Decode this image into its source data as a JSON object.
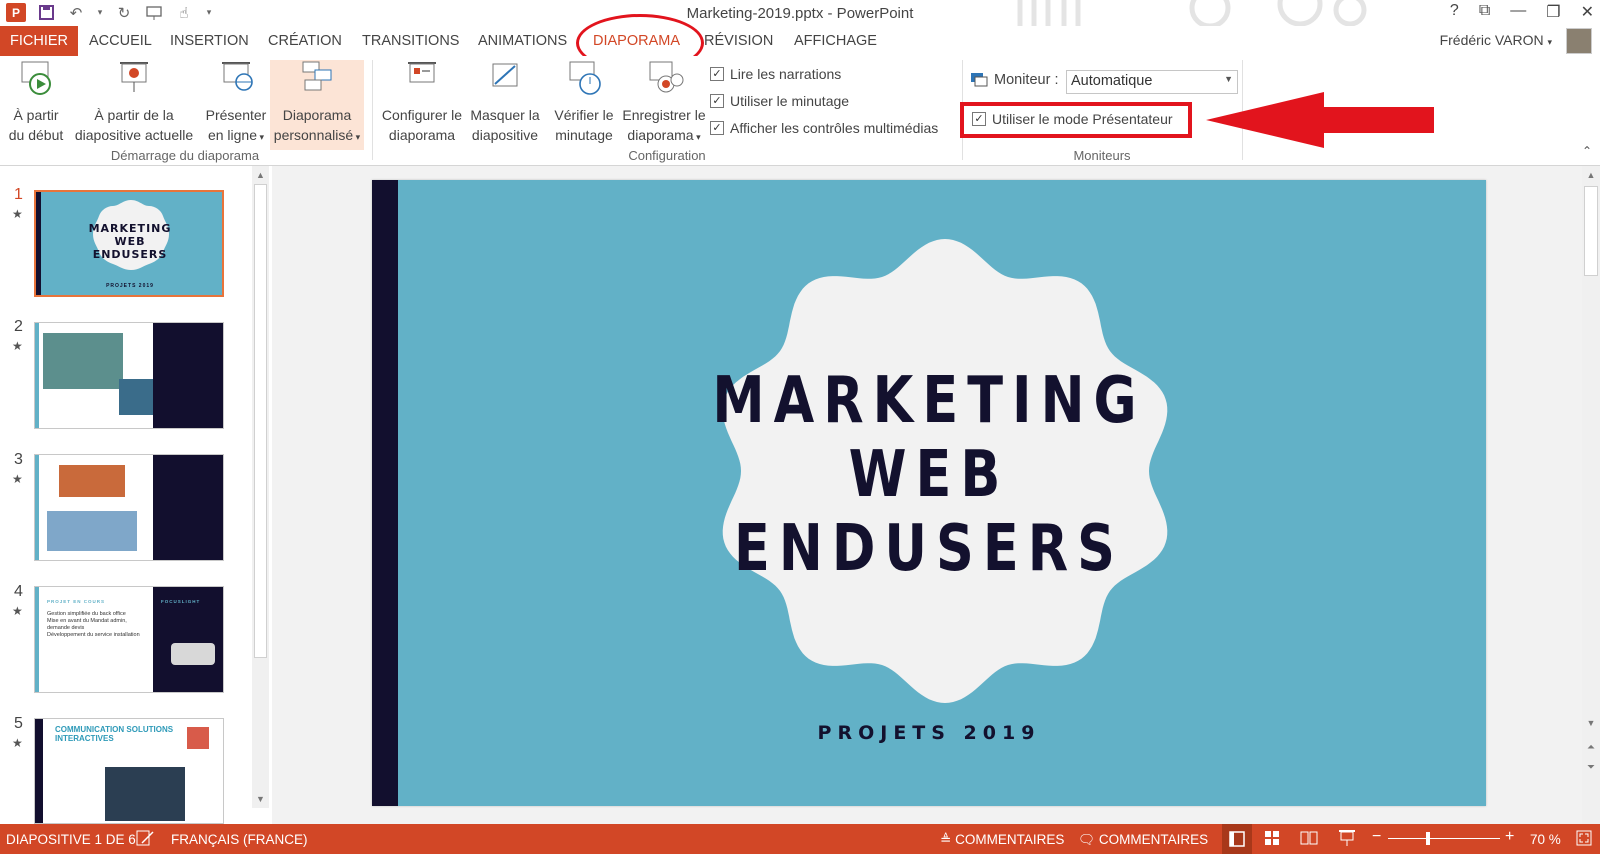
{
  "window": {
    "title": "Marketing-2019.pptx - PowerPoint"
  },
  "quick_access": [
    "powerpoint-logo",
    "save-icon",
    "undo-icon",
    "repeat-icon",
    "present-from-start-icon",
    "touch-mode-icon",
    "customize-icon"
  ],
  "window_controls": {
    "help": "?",
    "restore_ribbon": "⧉",
    "minimize": "—",
    "maximize": "❐",
    "close": "✕"
  },
  "tabs": [
    {
      "label": "FICHIER"
    },
    {
      "label": "ACCUEIL"
    },
    {
      "label": "INSERTION"
    },
    {
      "label": "CRÉATION"
    },
    {
      "label": "TRANSITIONS"
    },
    {
      "label": "ANIMATIONS"
    },
    {
      "label": "DIAPORAMA"
    },
    {
      "label": "RÉVISION"
    },
    {
      "label": "AFFICHAGE"
    }
  ],
  "active_tab": "DIAPORAMA",
  "user": {
    "name": "Frédéric VARON"
  },
  "ribbon": {
    "start": {
      "btn1": [
        "À partir",
        "du début"
      ],
      "btn2": [
        "À partir de la",
        "diapositive actuelle"
      ],
      "btn3": [
        "Présenter",
        "en ligne"
      ],
      "btn4": [
        "Diaporama",
        "personnalisé"
      ],
      "group": "Démarrage du diaporama"
    },
    "config": {
      "btn1": [
        "Configurer le",
        "diaporama"
      ],
      "btn2": [
        "Masquer la",
        "diapositive"
      ],
      "btn3": [
        "Vérifier le",
        "minutage"
      ],
      "btn4": [
        "Enregistrer le",
        "diaporama"
      ],
      "checks": [
        "Lire les narrations",
        "Utiliser le minutage",
        "Afficher les contrôles multimédias"
      ],
      "group": "Configuration"
    },
    "monitors": {
      "label": "Moniteur :",
      "value": "Automatique",
      "presenter": "Utiliser le mode Présentateur",
      "group": "Moniteurs"
    }
  },
  "slides": {
    "numbers": [
      "1",
      "2",
      "3",
      "4",
      "5"
    ],
    "s1": {
      "lines": [
        "MARKETING",
        "WEB",
        "ENDUSERS"
      ],
      "sub": "PROJETS 2019"
    },
    "s4": {
      "header": "PROJET EN COURS",
      "side": "FOCUSLIGHT",
      "bullets": [
        "Gestion simplifiée du back office",
        "Mise en avant du Mandat admin, demande devis",
        "Développement du service installation"
      ]
    },
    "s5": {
      "title": "COMMUNICATION SOLUTIONS INTERACTIVES"
    }
  },
  "main_slide": {
    "lines": [
      "MARKETING",
      "WEB",
      "ENDUSERS"
    ],
    "subtitle": "PROJETS 2019"
  },
  "status": {
    "slide": "DIAPOSITIVE 1 DE 6",
    "language": "FRANÇAIS (FRANCE)",
    "notes": "COMMENTAIRES",
    "comments": "COMMENTAIRES",
    "zoom": "70 %"
  },
  "colors": {
    "accent": "#d24726",
    "slide_bg": "#62b1c7",
    "slide_dark": "#120f2e",
    "highlight": "#e2141d"
  }
}
